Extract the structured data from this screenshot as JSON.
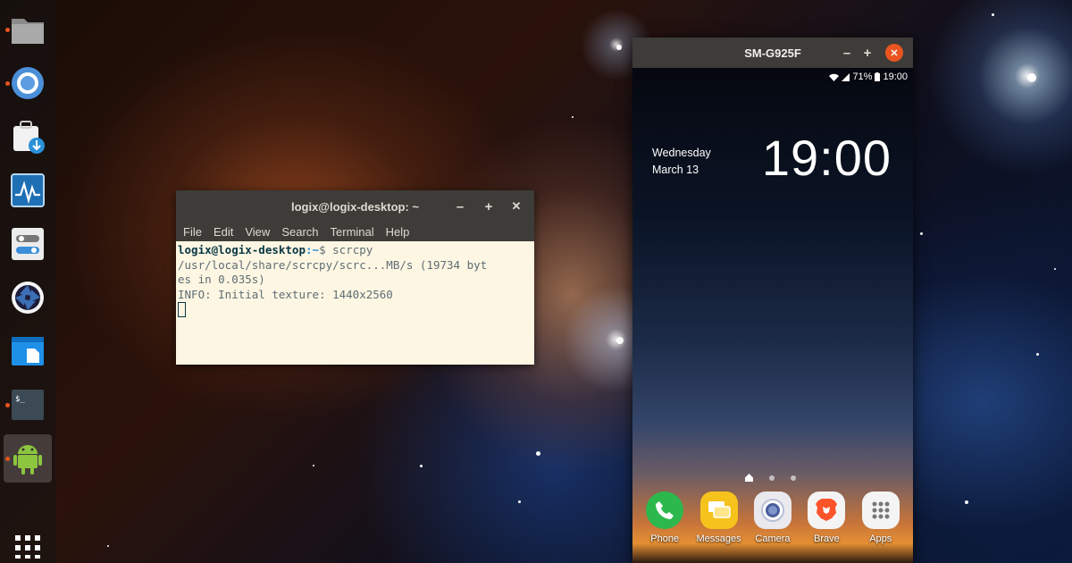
{
  "colors": {
    "accent": "#e95420",
    "terminal_bg": "#fdf6e3",
    "titlebar": "#3d3c38",
    "close_button": "#e95420"
  },
  "dock": {
    "items": [
      {
        "icon": "folder-icon",
        "running": true
      },
      {
        "icon": "chromium-icon",
        "running": true
      },
      {
        "icon": "software-download-icon",
        "running": false
      },
      {
        "icon": "system-monitor-icon",
        "running": false
      },
      {
        "icon": "settings-toggle-icon",
        "running": false
      },
      {
        "icon": "aperture-icon",
        "running": false
      },
      {
        "icon": "file-window-icon",
        "running": false
      },
      {
        "icon": "terminal-icon",
        "running": true
      },
      {
        "icon": "android-icon",
        "running": true,
        "active": true
      }
    ],
    "show_apps_icon": "grid-icon"
  },
  "terminal": {
    "title": "logix@logix-desktop: ~",
    "menu": [
      "File",
      "Edit",
      "View",
      "Search",
      "Terminal",
      "Help"
    ],
    "prompt_user": "logix@logix-desktop",
    "prompt_path": ":~",
    "prompt_symbol": "$ ",
    "command": "scrcpy",
    "output_lines": [
      "/usr/local/share/scrcpy/scrc...MB/s (19734 byt",
      "es in 0.035s)",
      "INFO: Initial texture: 1440x2560"
    ]
  },
  "phone_window": {
    "title": "SM-G925F",
    "status": {
      "battery": "71%",
      "time": "19:00"
    },
    "clock": "19:00",
    "date_line1": "Wednesday",
    "date_line2": "March 13",
    "apps": [
      {
        "label": "Phone",
        "icon": "phone-icon",
        "color": "#2db84d"
      },
      {
        "label": "Messages",
        "icon": "messages-icon",
        "color": "#f6c21c"
      },
      {
        "label": "Camera",
        "icon": "camera-icon",
        "color": "#e9e9ee"
      },
      {
        "label": "Brave",
        "icon": "brave-icon",
        "color": "#f4f4f4"
      },
      {
        "label": "Apps",
        "icon": "apps-grid-icon",
        "color": "#f4f4f4"
      }
    ]
  }
}
